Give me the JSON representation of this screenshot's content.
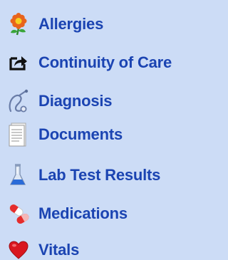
{
  "nav": {
    "items": [
      {
        "label": "Allergies",
        "icon": "flower-icon"
      },
      {
        "label": "Continuity of Care",
        "icon": "export-icon"
      },
      {
        "label": "Diagnosis",
        "icon": "stethoscope-icon"
      },
      {
        "label": "Documents",
        "icon": "document-icon"
      },
      {
        "label": "Lab Test Results",
        "icon": "flask-icon"
      },
      {
        "label": "Medications",
        "icon": "pills-icon"
      },
      {
        "label": "Vitals",
        "icon": "heart-icon"
      }
    ]
  },
  "colors": {
    "background": "#ccdcf6",
    "link": "#1b44b2"
  }
}
